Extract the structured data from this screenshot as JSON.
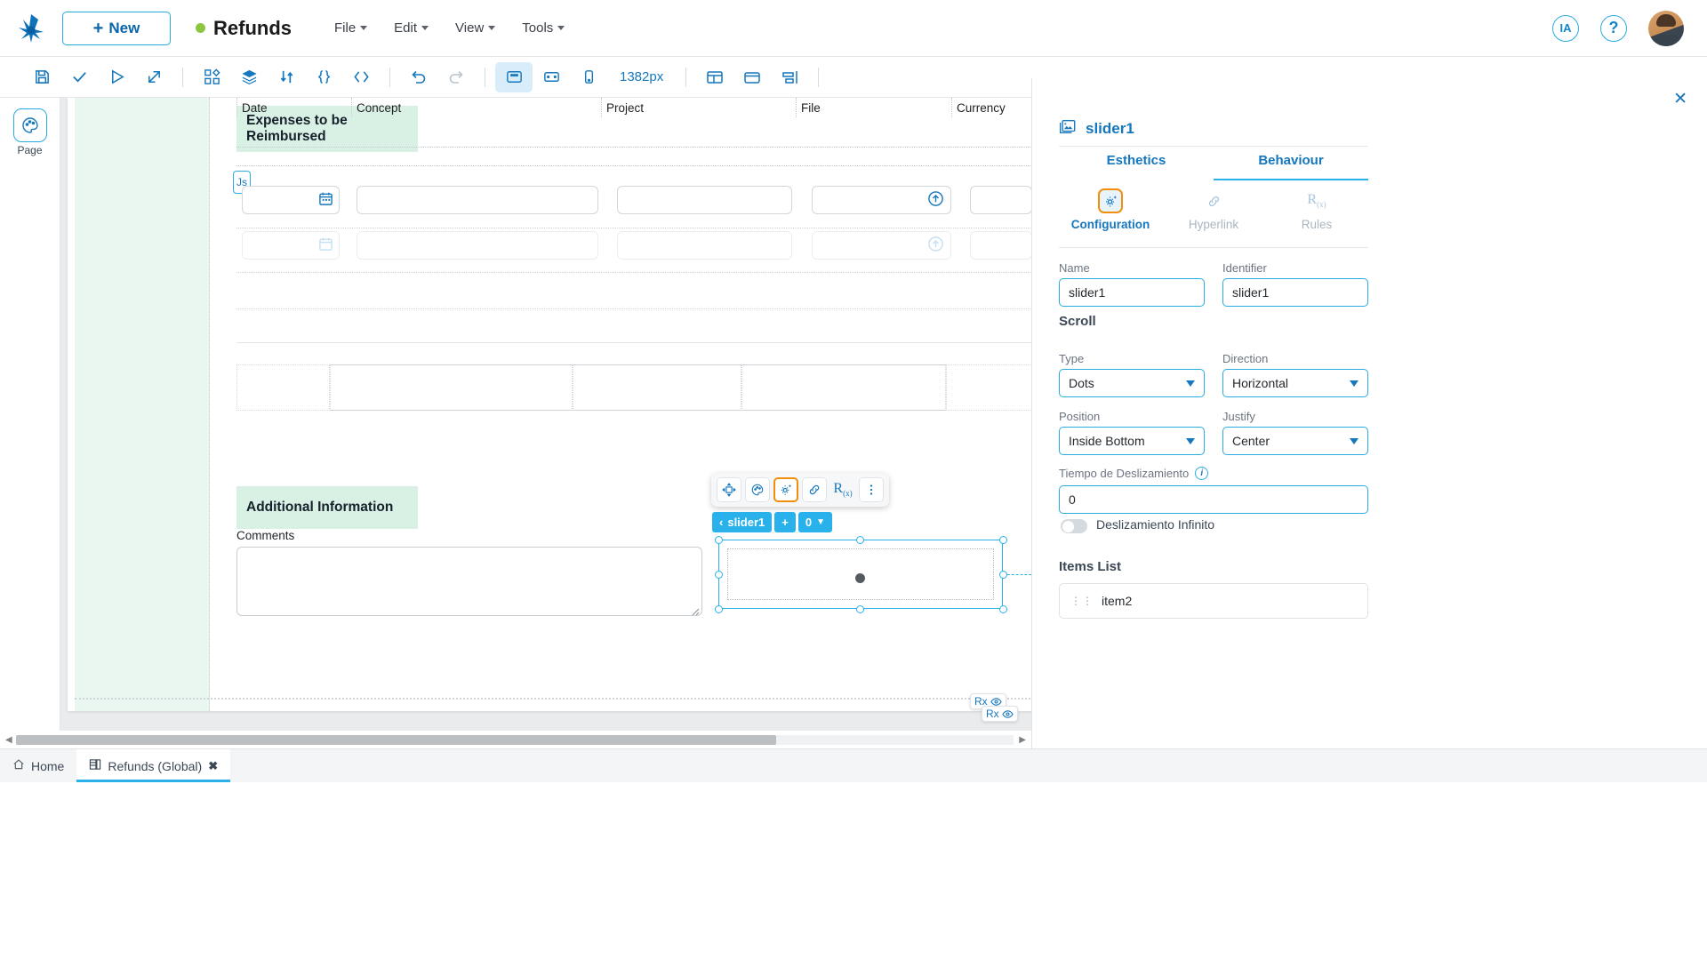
{
  "header": {
    "logo_icon": "genexus-logo-icon",
    "new_button": "New",
    "app_title": "Refunds",
    "menus": [
      "File",
      "Edit",
      "View",
      "Tools"
    ],
    "ia_badge": "IA",
    "help": "?",
    "avatar_alt": "user-avatar"
  },
  "toolbar": {
    "icons": [
      {
        "name": "save-icon",
        "glyph": "save"
      },
      {
        "name": "check-icon",
        "glyph": "check"
      },
      {
        "name": "run-icon",
        "glyph": "play"
      },
      {
        "name": "export-icon",
        "glyph": "export"
      },
      {
        "name": "components-icon",
        "glyph": "components"
      },
      {
        "name": "layers-icon",
        "glyph": "layers"
      },
      {
        "name": "variables-icon",
        "glyph": "variables"
      },
      {
        "name": "braces-icon",
        "glyph": "braces"
      },
      {
        "name": "code-icon",
        "glyph": "code"
      },
      {
        "name": "undo-icon",
        "glyph": "undo"
      },
      {
        "name": "redo-icon",
        "glyph": "redo"
      },
      {
        "name": "desktop-view-icon",
        "glyph": "desktop"
      },
      {
        "name": "tablet-view-icon",
        "glyph": "tablet"
      },
      {
        "name": "mobile-view-icon",
        "glyph": "mobile"
      },
      {
        "name": "split-panel-icon",
        "glyph": "split"
      },
      {
        "name": "container-icon",
        "glyph": "container"
      },
      {
        "name": "align-icon",
        "glyph": "align"
      }
    ],
    "width_value": "1382px"
  },
  "left_rail": {
    "items": [
      {
        "label": "Page",
        "icon": "palette-icon"
      }
    ]
  },
  "canvas": {
    "section_expenses": {
      "title": "Expenses to be Reimbursed",
      "columns": [
        "Date",
        "Concept",
        "Project",
        "File",
        "Currency"
      ],
      "js_tag": "Js"
    },
    "section_additional": {
      "title": "Additional Information",
      "comments_label": "Comments"
    },
    "element_tag": {
      "back_chevron": "‹",
      "name": "slider1",
      "add": "+",
      "index": "0"
    },
    "float_toolbar": [
      {
        "name": "move-icon",
        "selected": false
      },
      {
        "name": "palette-icon",
        "selected": false
      },
      {
        "name": "settings-icon",
        "selected": true
      },
      {
        "name": "link-icon",
        "selected": false
      },
      {
        "name": "rules-icon",
        "selected": false
      },
      {
        "name": "more-icon",
        "selected": false
      }
    ],
    "rx_badge": "Rx"
  },
  "right_panel": {
    "close_icon": "close-icon",
    "element_icon": "images-icon",
    "element_name": "slider1",
    "tabs": [
      {
        "label": "Esthetics",
        "active": false
      },
      {
        "label": "Behaviour",
        "active": true
      }
    ],
    "subtabs": [
      {
        "label": "Configuration",
        "icon": "settings-icon",
        "active": true
      },
      {
        "label": "Hyperlink",
        "icon": "link-icon",
        "active": false
      },
      {
        "label": "Rules",
        "icon": "rules-icon",
        "active": false
      }
    ],
    "fields": {
      "name_label": "Name",
      "name_value": "slider1",
      "identifier_label": "Identifier",
      "identifier_value": "slider1"
    },
    "scroll": {
      "group_title": "Scroll",
      "type_label": "Type",
      "type_value": "Dots",
      "direction_label": "Direction",
      "direction_value": "Horizontal",
      "position_label": "Position",
      "position_value": "Inside Bottom",
      "justify_label": "Justify",
      "justify_value": "Center",
      "slide_time_label": "Tiempo de Deslizamiento",
      "slide_time_value": "0",
      "infinite_label": "Deslizamiento Infinito"
    },
    "items_list": {
      "title": "Items List",
      "items": [
        "item2"
      ]
    }
  },
  "bottom_tabs": {
    "home": "Home",
    "active_tab": "Refunds (Global)",
    "close_glyph": "✖"
  },
  "colors": {
    "accent": "#28b1ea",
    "link": "#1577bd",
    "highlight": "#f18f0c",
    "section_bg": "#d9f0e4",
    "status": "#8cc63e"
  }
}
